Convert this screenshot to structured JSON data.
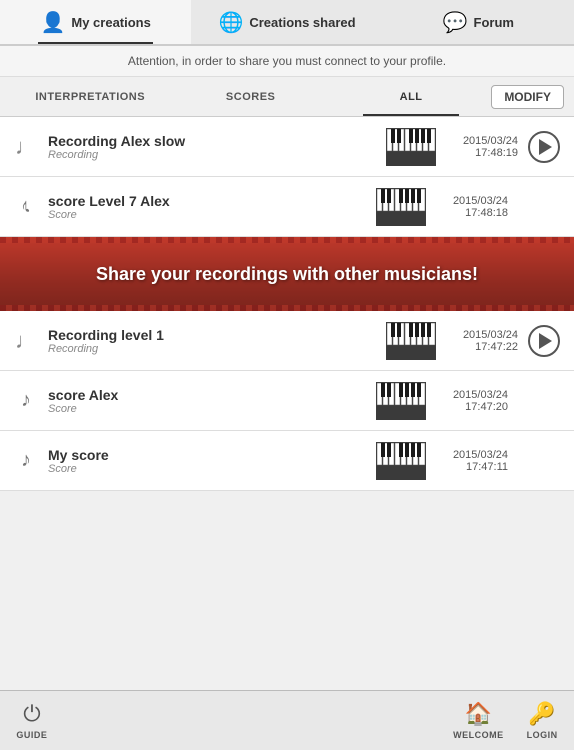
{
  "nav": {
    "tabs": [
      {
        "id": "my-creations",
        "label": "My creations",
        "icon": "👤",
        "active": true
      },
      {
        "id": "creations-shared",
        "label": "Creations shared",
        "icon": "🌐",
        "active": false
      },
      {
        "id": "forum",
        "label": "Forum",
        "icon": "💬",
        "active": false
      }
    ]
  },
  "attention": {
    "text": "Attention, in order to share you must connect to your profile."
  },
  "filters": {
    "tabs": [
      {
        "id": "interpretations",
        "label": "INTERPRETATIONS",
        "active": false
      },
      {
        "id": "scores",
        "label": "SCORES",
        "active": false
      },
      {
        "id": "all",
        "label": "ALL",
        "active": true
      }
    ],
    "modify_label": "MODIFY"
  },
  "items": [
    {
      "id": "item-1",
      "type_icon": "♩",
      "title": "Recording Alex slow",
      "subtitle": "Recording",
      "date": "2015/03/24",
      "time": "17:48:19",
      "has_play": true
    },
    {
      "id": "item-2",
      "type_icon": "𝄢",
      "title": "score Level 7 Alex",
      "subtitle": "Score",
      "date": "2015/03/24",
      "time": "17:48:18",
      "has_play": false
    }
  ],
  "promo": {
    "text": "Share your recordings with other musicians!"
  },
  "items_below": [
    {
      "id": "item-3",
      "type_icon": "♩",
      "title": "Recording level 1",
      "subtitle": "Recording",
      "date": "2015/03/24",
      "time": "17:47:22",
      "has_play": true
    },
    {
      "id": "item-4",
      "type_icon": "𝄢",
      "title": "score Alex",
      "subtitle": "Score",
      "date": "2015/03/24",
      "time": "17:47:20",
      "has_play": false
    },
    {
      "id": "item-5",
      "type_icon": "𝄢",
      "title": "My score",
      "subtitle": "Score",
      "date": "2015/03/24",
      "time": "17:47:11",
      "has_play": false
    }
  ],
  "bottom_bar": {
    "guide_label": "GUIDE",
    "welcome_label": "WELCOME",
    "login_label": "LOGIN"
  },
  "colors": {
    "accent": "#c0392b",
    "nav_bg": "#e8e8e8",
    "active_underline": "#333"
  }
}
